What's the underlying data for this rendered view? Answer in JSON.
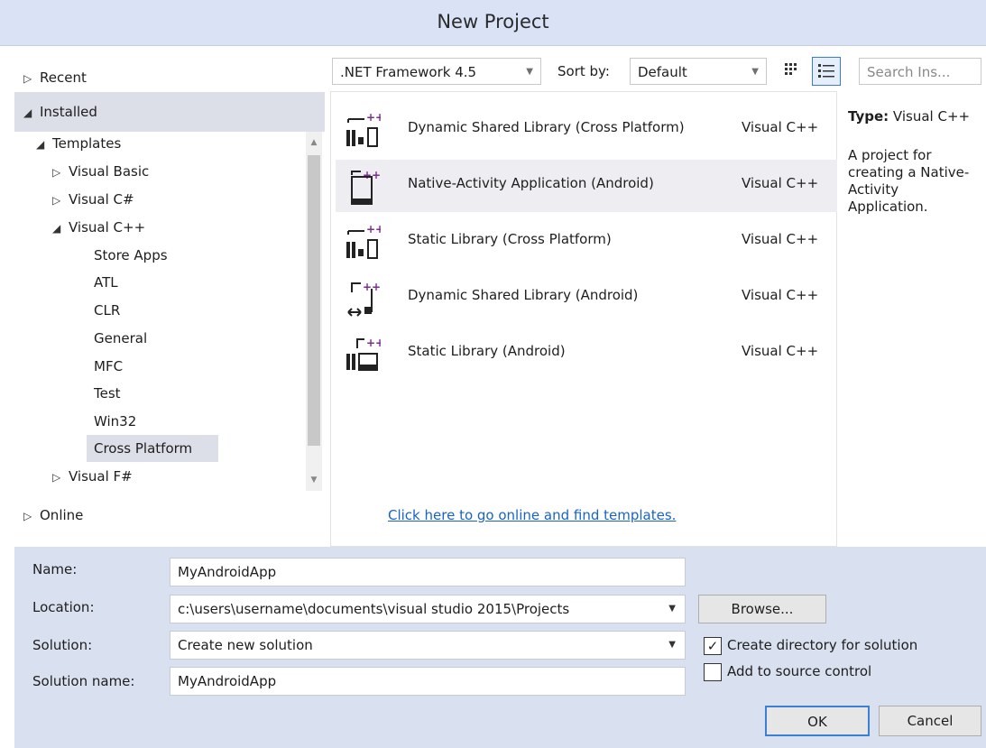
{
  "window": {
    "title": "New Project"
  },
  "tree": {
    "recent": "Recent",
    "installed": "Installed",
    "templates": "Templates",
    "visual_basic": "Visual Basic",
    "visual_csharp": "Visual C#",
    "visual_cpp": "Visual C++",
    "cpp_children": [
      "Store Apps",
      "ATL",
      "CLR",
      "General",
      "MFC",
      "Test",
      "Win32",
      "Cross Platform"
    ],
    "visual_fsharp": "Visual F#",
    "online": "Online"
  },
  "toolbar": {
    "framework": ".NET Framework 4.5",
    "sort_label": "Sort by:",
    "sort_value": "Default",
    "search_placeholder": "Search Ins..."
  },
  "templates": [
    {
      "name": "Dynamic Shared Library (Cross Platform)",
      "lang": "Visual C++",
      "icon": "cross-platform-library-icon"
    },
    {
      "name": "Native-Activity Application (Android)",
      "lang": "Visual C++",
      "icon": "android-app-icon"
    },
    {
      "name": "Static Library (Cross Platform)",
      "lang": "Visual C++",
      "icon": "cross-platform-library-icon"
    },
    {
      "name": "Dynamic Shared Library (Android)",
      "lang": "Visual C++",
      "icon": "android-shared-library-icon"
    },
    {
      "name": "Static Library (Android)",
      "lang": "Visual C++",
      "icon": "android-static-library-icon"
    }
  ],
  "online_link": "Click here to go online and find templates.",
  "details": {
    "type_label": "Type:",
    "type_value": "Visual C++",
    "description": "A project for creating a Native-Activity Application."
  },
  "form": {
    "name_label": "Name:",
    "name_value": "MyAndroidApp",
    "location_label": "Location:",
    "location_value": "c:\\users\\username\\documents\\visual studio 2015\\Projects",
    "solution_label": "Solution:",
    "solution_value": "Create new solution",
    "solution_name_label": "Solution name:",
    "solution_name_value": "MyAndroidApp",
    "browse": "Browse...",
    "create_dir": "Create directory for solution",
    "add_source_control": "Add to source control",
    "ok": "OK",
    "cancel": "Cancel"
  },
  "colors": {
    "accent": "#7b2c8f",
    "link": "#1a63c4",
    "selected": "#dcdee8"
  }
}
